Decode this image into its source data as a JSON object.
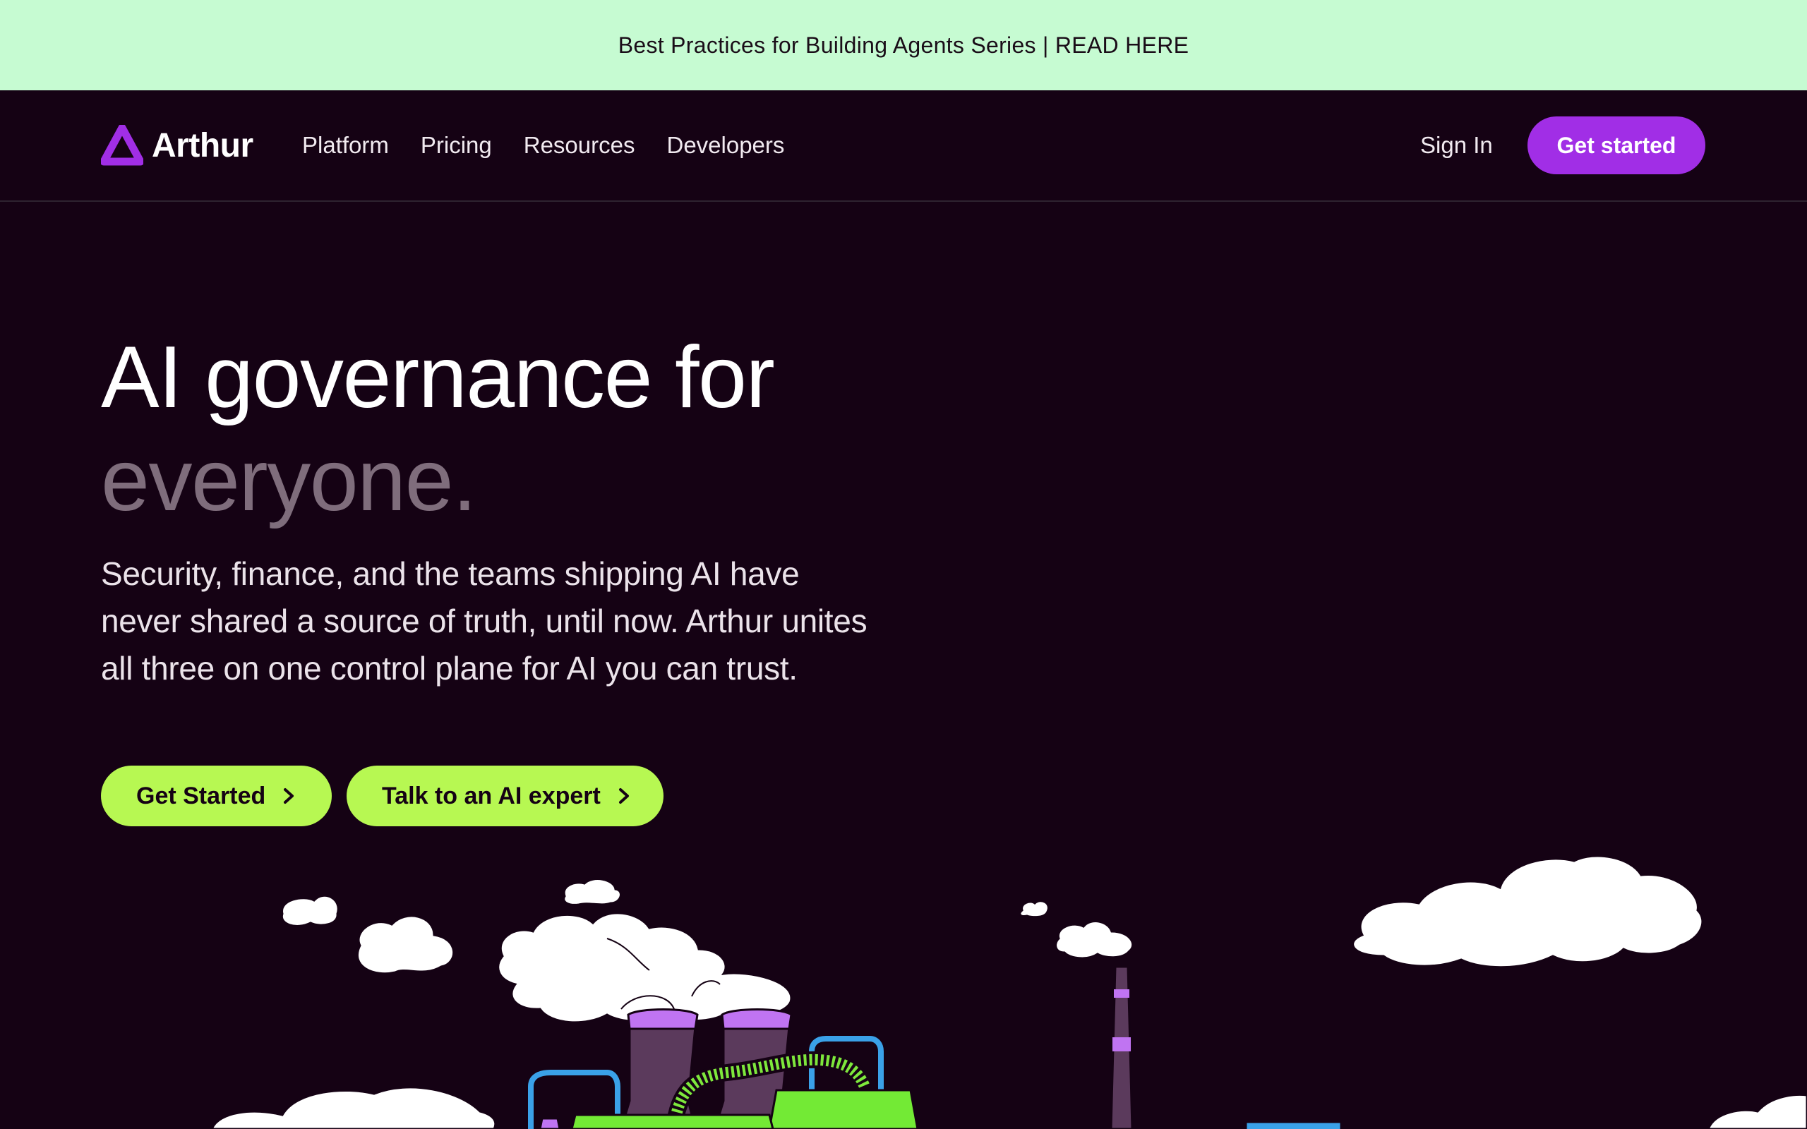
{
  "banner": {
    "text": "Best Practices for Building Agents Series | READ HERE"
  },
  "nav": {
    "logo": "Arthur",
    "links": [
      "Platform",
      "Pricing",
      "Resources",
      "Developers"
    ],
    "sign_in": "Sign In",
    "get_started": "Get started"
  },
  "hero": {
    "title_line1": "AI governance for",
    "title_line2": "everyone.",
    "subtitle": "Security, finance, and the teams shipping AI have never shared a source of truth, until now. Arthur unites all three on one control plane for AI you can trust.",
    "cta_primary": "Get Started",
    "cta_secondary": "Talk to an AI expert"
  },
  "colors": {
    "background": "#150214",
    "banner": "#c6fbd2",
    "brand_purple": "#a12ee6",
    "cta_green": "#b7f852",
    "muted_text": "#7f6d7c"
  },
  "icons": {
    "logo": "arthur-triangle-icon",
    "cta_arrow": "chevron-right-icon"
  }
}
